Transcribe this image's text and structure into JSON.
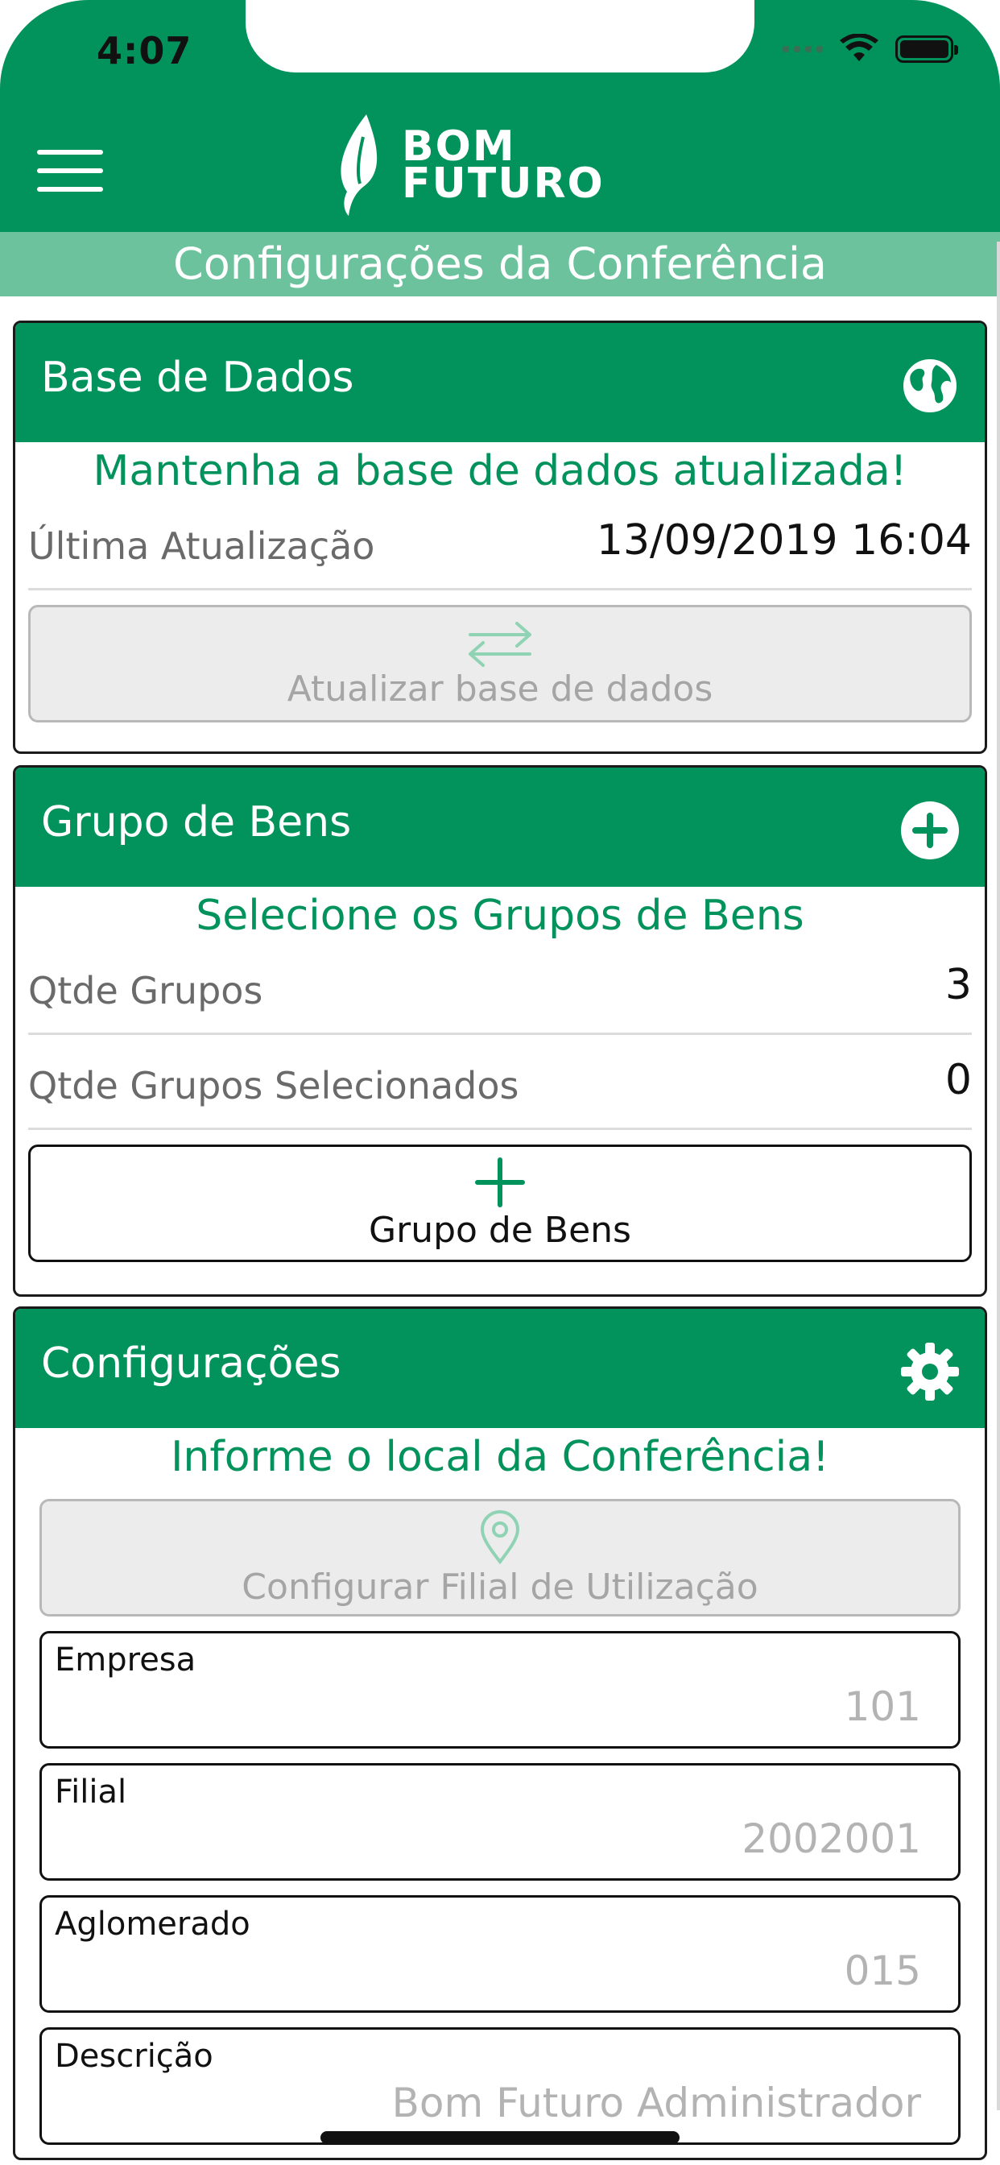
{
  "status_bar": {
    "time": "4:07"
  },
  "header": {
    "logo_line1": "BOM",
    "logo_line2": "FUTURO"
  },
  "page_title": "Configurações da Conferência",
  "base_de_dados": {
    "title": "Base de Dados",
    "icon": "globe-icon",
    "hint": "Mantenha a base de dados atualizada!",
    "last_update_label": "Última Atualização",
    "last_update_value": "13/09/2019 16:04",
    "update_button_label": "Atualizar base de dados"
  },
  "grupo_de_bens": {
    "title": "Grupo de Bens",
    "icon": "plus-circle-icon",
    "hint": "Selecione os Grupos de Bens",
    "qtde_grupos_label": "Qtde Grupos",
    "qtde_grupos_value": "3",
    "qtde_selecionados_label": "Qtde Grupos Selecionados",
    "qtde_selecionados_value": "0",
    "add_button_label": "Grupo de Bens"
  },
  "configuracoes": {
    "title": "Configurações",
    "icon": "gear-icon",
    "hint": "Informe o local da Conferência!",
    "configure_button_label": "Configurar Filial de Utilização",
    "fields": [
      {
        "label": "Empresa",
        "value": "101"
      },
      {
        "label": "Filial",
        "value": "2002001"
      },
      {
        "label": "Aglomerado",
        "value": "015"
      },
      {
        "label": "Descrição",
        "value": "Bom Futuro Administrador"
      }
    ]
  },
  "colors": {
    "brand_green": "#02935d",
    "light_green_bar": "#6cc29c",
    "disabled_gray": "#ececec"
  }
}
